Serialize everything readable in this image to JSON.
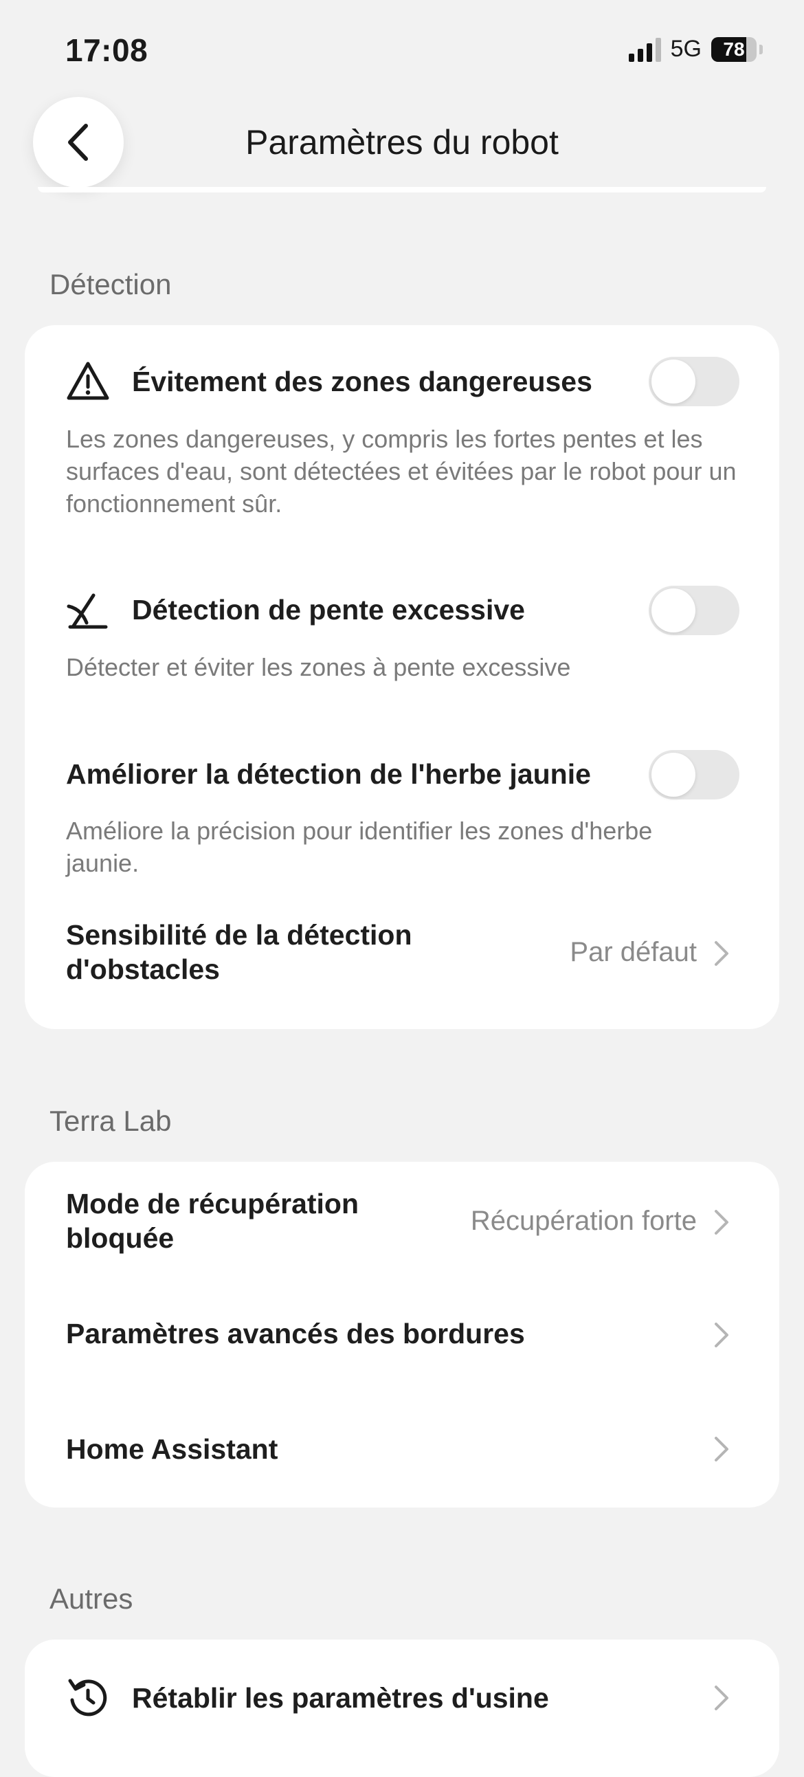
{
  "status_bar": {
    "time": "17:08",
    "network": "5G",
    "battery": "78",
    "battery_level": 0.78,
    "signal_bars_active": 3,
    "signal_bars_total": 4
  },
  "header": {
    "title": "Paramètres du robot",
    "back_icon": "chevron-left-icon"
  },
  "sections": {
    "detection": {
      "label": "Détection",
      "items": [
        {
          "title": "Évitement des zones dangereuses",
          "icon": "warning-triangle-icon",
          "description": "Les zones dangereuses, y compris les fortes pentes et les surfaces d'eau, sont détectées et évitées par le robot pour un fonctionnement sûr.",
          "enabled": false
        },
        {
          "title": "Détection de pente excessive",
          "icon": "slope-icon",
          "description": "Détecter et éviter les zones à pente excessive",
          "enabled": false
        },
        {
          "title": "Améliorer la détection de l'herbe jaunie",
          "description": "Améliore la précision pour identifier les zones d'herbe jaunie.",
          "enabled": false
        }
      ],
      "nav": {
        "title_line1": "Sensibilité de la détection",
        "title_line2": "d'obstacles",
        "value": "Par défaut"
      }
    },
    "terra_lab": {
      "label": "Terra Lab",
      "items": [
        {
          "title_line1": "Mode de récupération",
          "title_line2": "bloquée",
          "value": "Récupération forte"
        },
        {
          "title": "Paramètres avancés des bordures",
          "value": ""
        },
        {
          "title": "Home Assistant",
          "value": ""
        }
      ]
    },
    "autres": {
      "label": "Autres",
      "items": [
        {
          "title": "Rétablir les paramètres d'usine",
          "icon": "reset-icon"
        }
      ]
    }
  },
  "colors": {
    "background": "#f2f2f2",
    "card": "#ffffff",
    "toggle_off": "#e7e7e7",
    "secondary_text": "#7a7a7a"
  }
}
